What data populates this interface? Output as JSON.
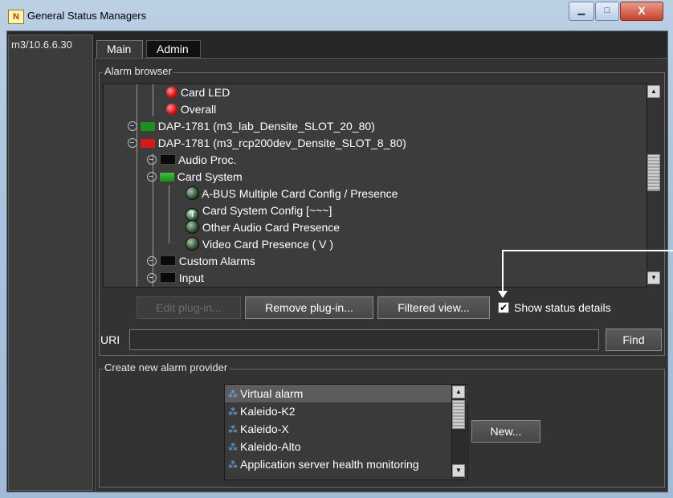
{
  "window": {
    "title": "General Status Managers",
    "app_icon_glyph": "N",
    "minimize_glyph": "▁",
    "maximize_glyph": "□",
    "close_glyph": "X"
  },
  "left_panel": {
    "label": "m3/10.6.6.30"
  },
  "tabs": [
    {
      "label": "Main",
      "active": true
    },
    {
      "label": "Admin",
      "active": false
    }
  ],
  "alarm_browser": {
    "title": "Alarm browser",
    "tree": [
      {
        "label": "Card LED",
        "icon": "red-led-icon"
      },
      {
        "label": "Overall",
        "icon": "red-led-icon"
      },
      {
        "label": "DAP-1781 (m3_lab_Densite_SLOT_20_80)",
        "icon": "green-folder-icon"
      },
      {
        "label": "DAP-1781 (m3_rcp200dev_Densite_SLOT_8_80)",
        "icon": "red-folder-icon"
      },
      {
        "label": "Audio Proc.",
        "icon": "black-folder-icon"
      },
      {
        "label": "Card System",
        "icon": "open-green-folder-icon"
      },
      {
        "label": "A-BUS Multiple Card Config / Presence",
        "icon": "status-ball-icon"
      },
      {
        "label": "Card System Config [~~~]",
        "icon": "T-ball-icon",
        "badge": "T"
      },
      {
        "label": "Other Audio Card Presence",
        "icon": "status-ball-icon"
      },
      {
        "label": "Video Card Presence ( V )",
        "icon": "status-ball-icon"
      },
      {
        "label": "Custom Alarms",
        "icon": "black-folder-icon"
      },
      {
        "label": "Input",
        "icon": "black-folder-icon"
      }
    ],
    "buttons": {
      "edit": "Edit plug-in...",
      "remove": "Remove plug-in...",
      "filtered": "Filtered view..."
    },
    "show_status_details": {
      "label": "Show status details",
      "checked": true,
      "check_glyph": "✔"
    },
    "scroll_up_glyph": "▲",
    "scroll_down_glyph": "▼"
  },
  "uri": {
    "label": "URI",
    "value": "",
    "find_label": "Find"
  },
  "create_provider": {
    "title": "Create new alarm provider",
    "items": [
      {
        "label": "Virtual alarm",
        "selected": true
      },
      {
        "label": "Kaleido-K2",
        "selected": false
      },
      {
        "label": "Kaleido-X",
        "selected": false
      },
      {
        "label": "Kaleido-Alto",
        "selected": false
      },
      {
        "label": "Application server health monitoring",
        "selected": false
      }
    ],
    "item_glyph": "⁂",
    "new_label": "New..."
  }
}
